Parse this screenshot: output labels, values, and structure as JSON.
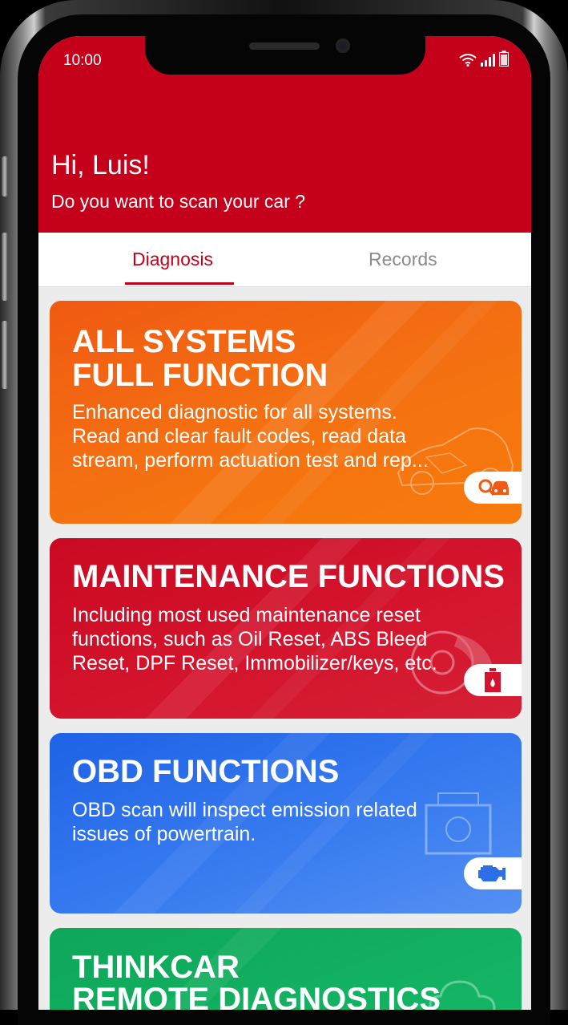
{
  "status_bar": {
    "time": "10:00"
  },
  "header": {
    "greeting": "Hi,  Luis!",
    "question": "Do you want to scan your car ?"
  },
  "tabs": [
    {
      "label": "Diagnosis",
      "active": true
    },
    {
      "label": "Records",
      "active": false
    }
  ],
  "cards": [
    {
      "title_lines": [
        "ALL SYSTEMS",
        "FULL FUNCTION"
      ],
      "desc_lines": [
        "Enhanced diagnostic for all systems.",
        "Read and clear fault codes, read data",
        "stream, perform actuation test and rep..."
      ],
      "icon": "car-search-icon",
      "color": "#f47012"
    },
    {
      "title_lines": [
        "MAINTENANCE FUNCTIONS"
      ],
      "desc_lines": [
        "Including most used maintenance reset",
        "functions, such as Oil Reset, ABS Bleed",
        "Reset, DPF Reset, Immobilizer/keys, etc."
      ],
      "icon": "oil-can-icon",
      "color": "#d4142d"
    },
    {
      "title_lines": [
        "OBD FUNCTIONS"
      ],
      "desc_lines": [
        "OBD scan will inspect emission related",
        "issues of powertrain."
      ],
      "icon": "engine-icon",
      "color": "#3a7df0"
    },
    {
      "title_lines": [
        "THINKCAR",
        "REMOTE DIAGNOSTICS"
      ],
      "desc_lines": [],
      "icon": "cloud-icon",
      "color": "#14b866"
    }
  ],
  "colors": {
    "brand": "#c4001a",
    "tab_inactive": "#8a8a8a"
  }
}
